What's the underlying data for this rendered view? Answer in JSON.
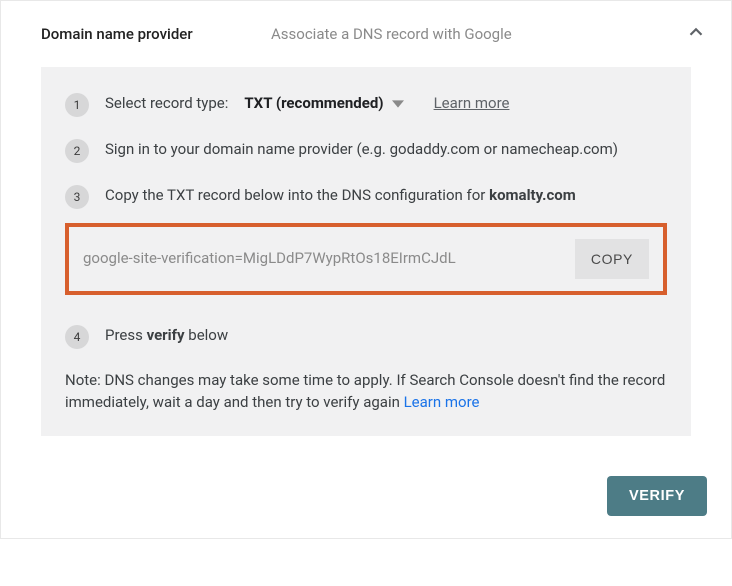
{
  "header": {
    "title": "Domain name provider",
    "subtitle": "Associate a DNS record with Google"
  },
  "steps": {
    "s1": {
      "num": "1",
      "label": "Select record type:",
      "selectValue": "TXT (recommended)",
      "learnMore": "Learn more"
    },
    "s2": {
      "num": "2",
      "text": "Sign in to your domain name provider (e.g. godaddy.com or namecheap.com)"
    },
    "s3": {
      "num": "3",
      "prefix": "Copy the TXT record below into the DNS configuration for ",
      "domain": "komalty.com",
      "txtRecord": "google-site-verification=MigLDdP7WypRtOs18EIrmCJdL",
      "copyLabel": "COPY"
    },
    "s4": {
      "num": "4",
      "prefix": "Press ",
      "bold": "verify",
      "suffix": " below"
    }
  },
  "note": {
    "text": "Note: DNS changes may take some time to apply. If Search Console doesn't find the record immediately, wait a day and then try to verify again ",
    "link": "Learn more"
  },
  "footer": {
    "verifyLabel": "VERIFY"
  }
}
